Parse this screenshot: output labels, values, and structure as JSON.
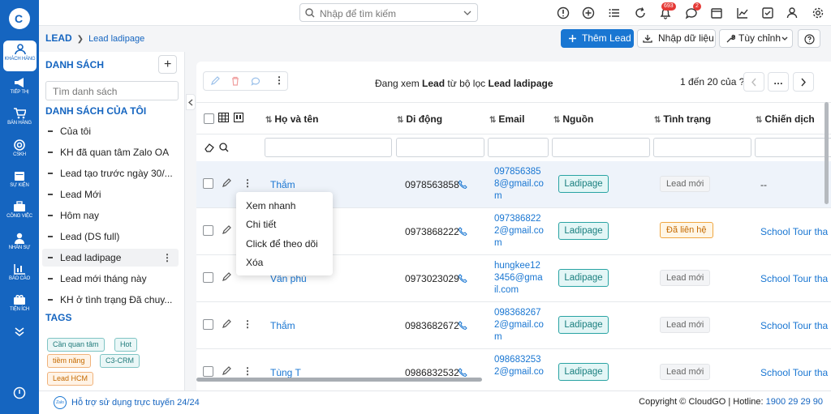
{
  "rail": {
    "logo": "C",
    "items": [
      {
        "label": "KHÁCH HÀNG",
        "icon": "users-icon"
      },
      {
        "label": "TIẾP THỊ",
        "icon": "megaphone-icon"
      },
      {
        "label": "BÁN HÀNG",
        "icon": "cart-icon"
      },
      {
        "label": "CSKH",
        "icon": "support-icon"
      },
      {
        "label": "SỰ KIỆN",
        "icon": "calendar-icon"
      },
      {
        "label": "CÔNG VIỆC",
        "icon": "briefcase-icon"
      },
      {
        "label": "NHÂN SỰ",
        "icon": "person-icon"
      },
      {
        "label": "BÁO CÁO",
        "icon": "report-icon"
      },
      {
        "label": "TIỆN ÍCH",
        "icon": "utilities-icon"
      }
    ]
  },
  "topbar": {
    "search_placeholder": "Nhập để tìm kiếm",
    "notifications_count": "693",
    "messages_count": "2"
  },
  "breadcrumb": {
    "root": "LEAD",
    "current": "Lead ladipage"
  },
  "actions": {
    "add": "Thêm Lead",
    "import": "Nhập dữ liệu",
    "customize": "Tùy chỉnh"
  },
  "sidebar": {
    "list_title": "DANH SÁCH",
    "search_placeholder": "Tìm danh sách",
    "my_lists_title": "DANH SÁCH CỦA TÔI",
    "items": [
      "Của tôi",
      "KH đã quan tâm Zalo OA",
      "Lead tạo trước ngày 30/...",
      "Lead Mới",
      "Hôm nay",
      "Lead (DS full)",
      "Lead ladipage",
      "Lead mới tháng này",
      "KH ở tình trạng Đã chuy..."
    ],
    "tags_title": "TAGS",
    "tags": [
      "Cần quan tâm",
      "Hot",
      "tiềm năng",
      "C3-CRM",
      "Lead HCM"
    ]
  },
  "toolbar": {
    "viewing_prefix": "Đang xem",
    "viewing_module": "Lead",
    "viewing_middle": "từ bộ lọc",
    "viewing_filter": "Lead ladipage",
    "page_info": "1 đến 20 của",
    "page_total": "?"
  },
  "table": {
    "headers": [
      "Họ và tên",
      "Di động",
      "Email",
      "Nguồn",
      "Tình trạng",
      "Chiến dịch"
    ],
    "rows": [
      {
        "name": "Thắm",
        "phone": "0978563858",
        "email": "0978563858@gmail.com",
        "source": "Ladipage",
        "status": "Lead mới",
        "campaign": "--"
      },
      {
        "name": "",
        "phone": "0973868222",
        "email": "0973868222@gmail.com",
        "source": "Ladipage",
        "status": "Đã liên hệ",
        "campaign": "School Tour tha"
      },
      {
        "name": "Vân phù",
        "phone": "0973023029",
        "email": "hungkee123456@gmail.com",
        "source": "Ladipage",
        "status": "Lead mới",
        "campaign": "School Tour tha"
      },
      {
        "name": "Thắm",
        "phone": "0983682672",
        "email": "0983682672@gmail.com",
        "source": "Ladipage",
        "status": "Lead mới",
        "campaign": "School Tour tha"
      },
      {
        "name": "Tùng T",
        "phone": "0986832532",
        "email": "0986832532@gmail.co",
        "source": "Ladipage",
        "status": "Lead mới",
        "campaign": "School Tour tha"
      }
    ]
  },
  "context_menu": [
    "Xem nhanh",
    "Chi tiết",
    "Click để theo dõi",
    "Xóa"
  ],
  "footer": {
    "zalo_label": "Zalo",
    "help": "Hỗ trợ sử dụng trực tuyến 24/24",
    "copyright": "Copyright © CloudGO | Hotline: ",
    "hotline": "1900 29 29 90"
  },
  "colors": {
    "brand": "#1565c0",
    "primary": "#1976d2",
    "source_tag": "#29a3a3",
    "contacted": "#f0a640",
    "badge": "#e53935"
  }
}
